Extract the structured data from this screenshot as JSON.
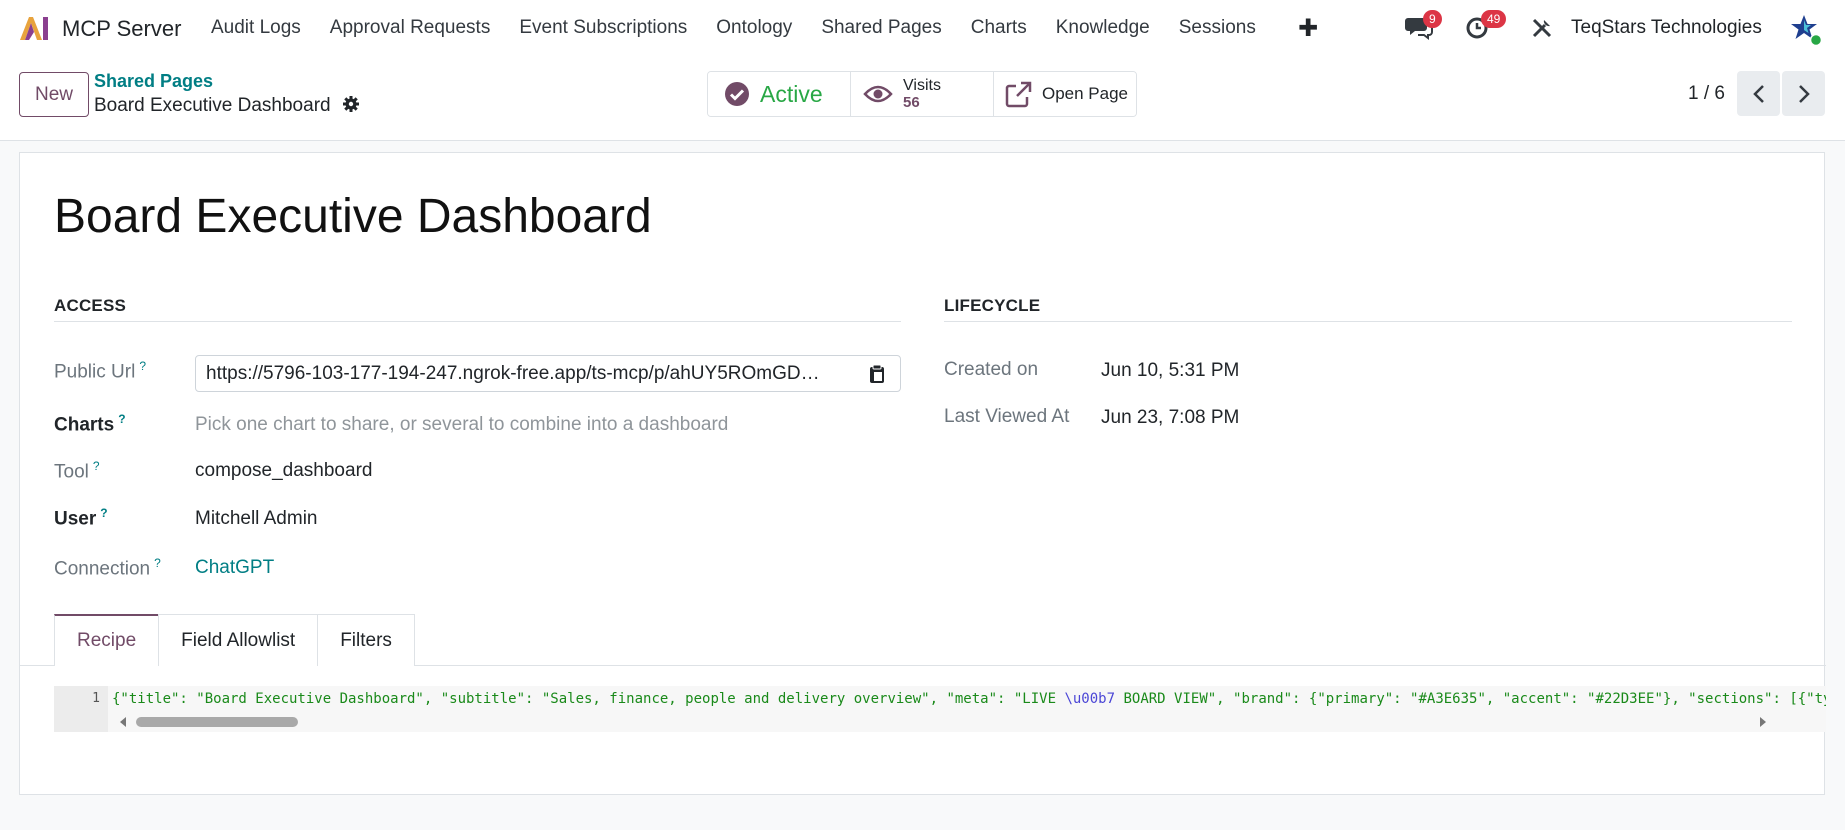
{
  "navbar": {
    "app_name": "MCP Server",
    "menu": [
      "Audit Logs",
      "Approval Requests",
      "Event Subscriptions",
      "Ontology",
      "Shared Pages",
      "Charts",
      "Knowledge",
      "Sessions"
    ],
    "messages_badge": "9",
    "activities_badge": "49",
    "company": "TeqStars Technologies"
  },
  "control": {
    "new_label": "New",
    "breadcrumb_parent": "Shared Pages",
    "breadcrumb_current": "Board Executive Dashboard",
    "status_label": "Active",
    "visits_label": "Visits",
    "visits_value": "56",
    "open_page_label": "Open Page",
    "pager": "1 / 6"
  },
  "form": {
    "title": "Board Executive Dashboard",
    "access_header": "ACCESS",
    "lifecycle_header": "LIFECYCLE",
    "public_url_label": "Public Url",
    "public_url_value": "https://5796-103-177-194-247.ngrok-free.app/ts-mcp/p/ahUY5ROmGD…",
    "charts_label": "Charts",
    "charts_placeholder": "Pick one chart to share, or several to combine into a dashboard",
    "tool_label": "Tool",
    "tool_value": "compose_dashboard",
    "user_label": "User",
    "user_value": "Mitchell Admin",
    "connection_label": "Connection",
    "connection_value": "ChatGPT",
    "created_label": "Created on",
    "created_value": "Jun 10, 5:31 PM",
    "last_viewed_label": "Last Viewed At",
    "last_viewed_value": "Jun 23, 7:08 PM",
    "help_mark": "?"
  },
  "tabs": [
    "Recipe",
    "Field Allowlist",
    "Filters"
  ],
  "editor": {
    "line_number": "1",
    "code_before": "{\"title\": \"Board Executive Dashboard\", \"subtitle\": \"Sales, finance, people and delivery overview\", \"meta\": \"LIVE ",
    "code_escape": "\\u00b7",
    "code_after": " BOARD VIEW\", \"brand\": {\"primary\": \"#A3E635\", \"accent\": \"#22D3EE\"}, \"sections\": [{\"type\""
  },
  "colors": {
    "primary": "#714b67",
    "link": "#017e84",
    "active": "#28a745",
    "badge": "#dc3545"
  }
}
